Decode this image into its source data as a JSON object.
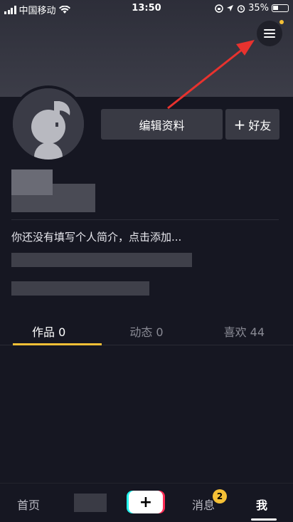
{
  "status_bar": {
    "carrier": "中国移动",
    "time": "13:50",
    "battery": "35%"
  },
  "header": {
    "menu_icon": "hamburger-menu-icon",
    "menu_dot_color": "#f5c036"
  },
  "profile": {
    "edit_label": "编辑资料",
    "add_friend_label": "好友",
    "add_friend_icon": "+",
    "bio": "你还没有填写个人简介，点击添加..."
  },
  "tabs": [
    {
      "label": "作品 0",
      "active": true
    },
    {
      "label": "动态 0",
      "active": false
    },
    {
      "label": "喜欢 44",
      "active": false
    }
  ],
  "bottom_nav": {
    "home": "首页",
    "messages": "消息",
    "messages_badge": "2",
    "me": "我",
    "create": "+"
  },
  "colors": {
    "accent": "#f5c036",
    "background": "#161722",
    "arrow": "#e8322e"
  }
}
